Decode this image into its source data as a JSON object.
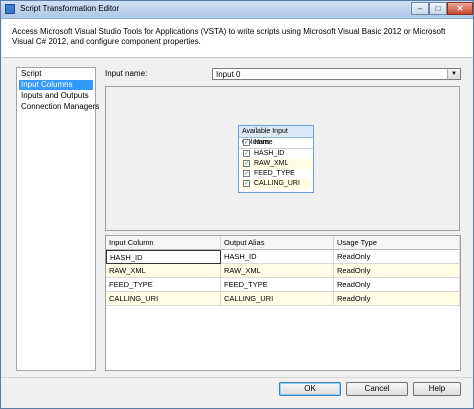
{
  "window": {
    "title": "Script Transformation Editor",
    "controls": {
      "minimize": "–",
      "maximize": "□",
      "close": "✕"
    }
  },
  "header": {
    "description": "Access Microsoft Visual Studio Tools for Applications (VSTA) to write scripts using Microsoft Visual Basic 2012 or Microsoft Visual C# 2012, and configure component properties."
  },
  "nav": {
    "items": [
      {
        "label": "Script",
        "selected": false
      },
      {
        "label": "Input Columns",
        "selected": true
      },
      {
        "label": "Inputs and Outputs",
        "selected": false
      },
      {
        "label": "Connection Managers",
        "selected": false
      }
    ]
  },
  "input": {
    "label": "Input name:",
    "value": "Input 0"
  },
  "available_columns": {
    "title": "Available Input Columns",
    "header": "Name",
    "columns": [
      {
        "name": "HASH_ID",
        "checked": true
      },
      {
        "name": "RAW_XML",
        "checked": true
      },
      {
        "name": "FEED_TYPE",
        "checked": true
      },
      {
        "name": "CALLING_URI",
        "checked": true
      }
    ]
  },
  "grid": {
    "headers": [
      "Input Column",
      "Output Alias",
      "Usage Type"
    ],
    "rows": [
      [
        "HASH_ID",
        "HASH_ID",
        "ReadOnly"
      ],
      [
        "RAW_XML",
        "RAW_XML",
        "ReadOnly"
      ],
      [
        "FEED_TYPE",
        "FEED_TYPE",
        "ReadOnly"
      ],
      [
        "CALLING_URI",
        "CALLING_URI",
        "ReadOnly"
      ]
    ]
  },
  "buttons": {
    "ok": "OK",
    "cancel": "Cancel",
    "help": "Help"
  },
  "colors": {
    "selection": "#3399ff",
    "alt_row": "#fffde6",
    "checkmark": "#22aa55"
  }
}
